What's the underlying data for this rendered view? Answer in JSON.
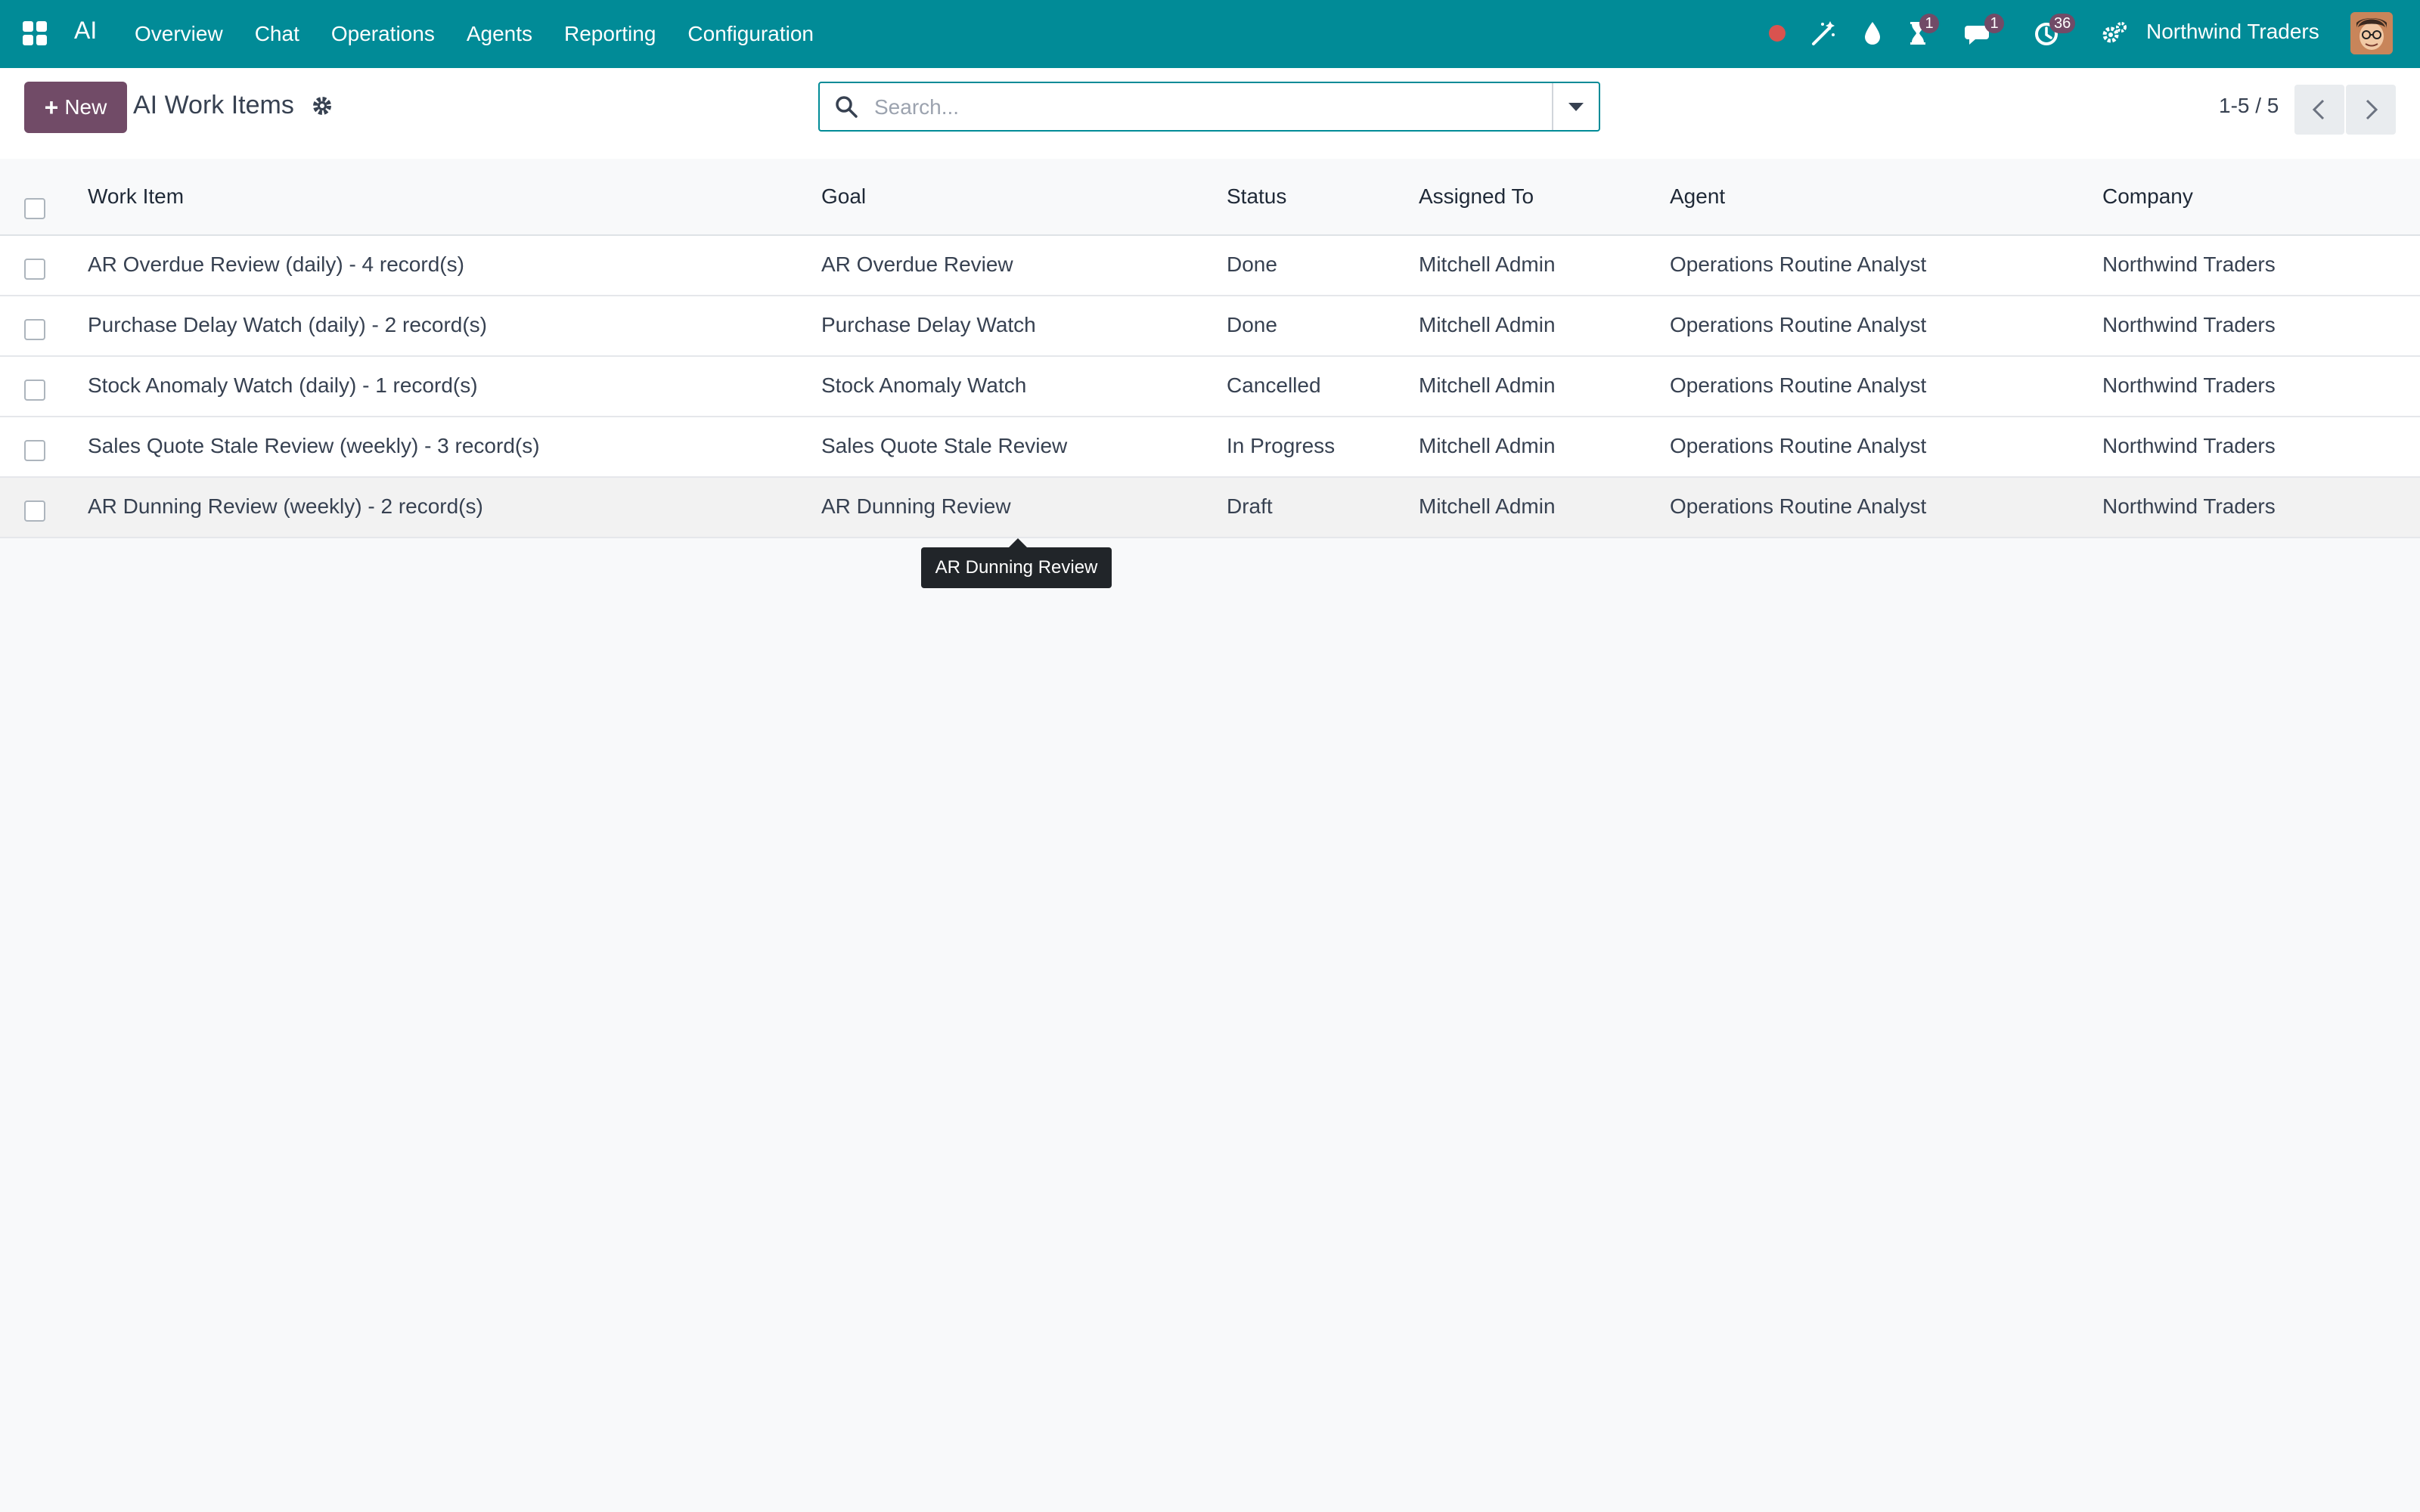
{
  "navbar": {
    "brand": "AI",
    "menu": [
      "Overview",
      "Chat",
      "Operations",
      "Agents",
      "Reporting",
      "Configuration"
    ],
    "company": "Northwind Traders",
    "badges": {
      "activity": "1",
      "messages": "1",
      "clock": "36"
    },
    "colors": {
      "navbar": "#018b97",
      "badge": "#714b67",
      "record_dot": "#d9534f"
    }
  },
  "control": {
    "new_label": "New",
    "title": "AI Work Items",
    "search_placeholder": "Search...",
    "pager": "1-5 / 5"
  },
  "table": {
    "headers": [
      "Work Item",
      "Goal",
      "Status",
      "Assigned To",
      "Agent",
      "Company"
    ],
    "rows": [
      [
        "AR Overdue Review (daily) - 4 record(s)",
        "AR Overdue Review",
        "Done",
        "Mitchell Admin",
        "Operations Routine Analyst",
        "Northwind Traders"
      ],
      [
        "Purchase Delay Watch (daily) - 2 record(s)",
        "Purchase Delay Watch",
        "Done",
        "Mitchell Admin",
        "Operations Routine Analyst",
        "Northwind Traders"
      ],
      [
        "Stock Anomaly Watch (daily) - 1 record(s)",
        "Stock Anomaly Watch",
        "Cancelled",
        "Mitchell Admin",
        "Operations Routine Analyst",
        "Northwind Traders"
      ],
      [
        "Sales Quote Stale Review (weekly) - 3 record(s)",
        "Sales Quote Stale Review",
        "In Progress",
        "Mitchell Admin",
        "Operations Routine Analyst",
        "Northwind Traders"
      ],
      [
        "AR Dunning Review (weekly) - 2 record(s)",
        "AR Dunning Review",
        "Draft",
        "Mitchell Admin",
        "Operations Routine Analyst",
        "Northwind Traders"
      ]
    ]
  },
  "tooltip": "AR Dunning Review"
}
